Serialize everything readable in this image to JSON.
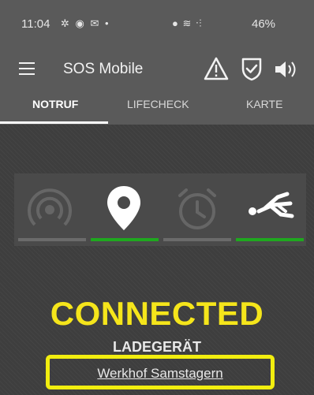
{
  "status_bar": {
    "time": "11:04",
    "left_icons": "✲ ◉ ✉ •",
    "right_icons": "● ≋ ᐧ⫶",
    "battery": "46%"
  },
  "app_bar": {
    "title": "SOS Mobile",
    "icons": [
      "menu-icon",
      "warning-icon",
      "shield-check-icon",
      "volume-icon"
    ]
  },
  "tabs": [
    {
      "label": "NOTRUF",
      "active": true
    },
    {
      "label": "LIFECHECK",
      "active": false
    },
    {
      "label": "KARTE",
      "active": false
    }
  ],
  "sensors": [
    {
      "icon": "signal-icon",
      "active": false,
      "bar_color": "#6b6b6b"
    },
    {
      "icon": "location-icon",
      "active": true,
      "bar_color": "#1fa81f"
    },
    {
      "icon": "timer-icon",
      "active": false,
      "bar_color": "#6b6b6b"
    },
    {
      "icon": "man-down-icon",
      "active": true,
      "bar_color": "#1fa81f"
    }
  ],
  "main": {
    "status": "CONNECTED",
    "device_type": "LADEGERÄT",
    "location": "Werkhof Samstagern"
  },
  "colors": {
    "status_yellow": "#f5e51b",
    "highlight_yellow": "#f2ee0f",
    "active_green": "#1fa81f",
    "appbar_gray": "#5a5a5a"
  }
}
